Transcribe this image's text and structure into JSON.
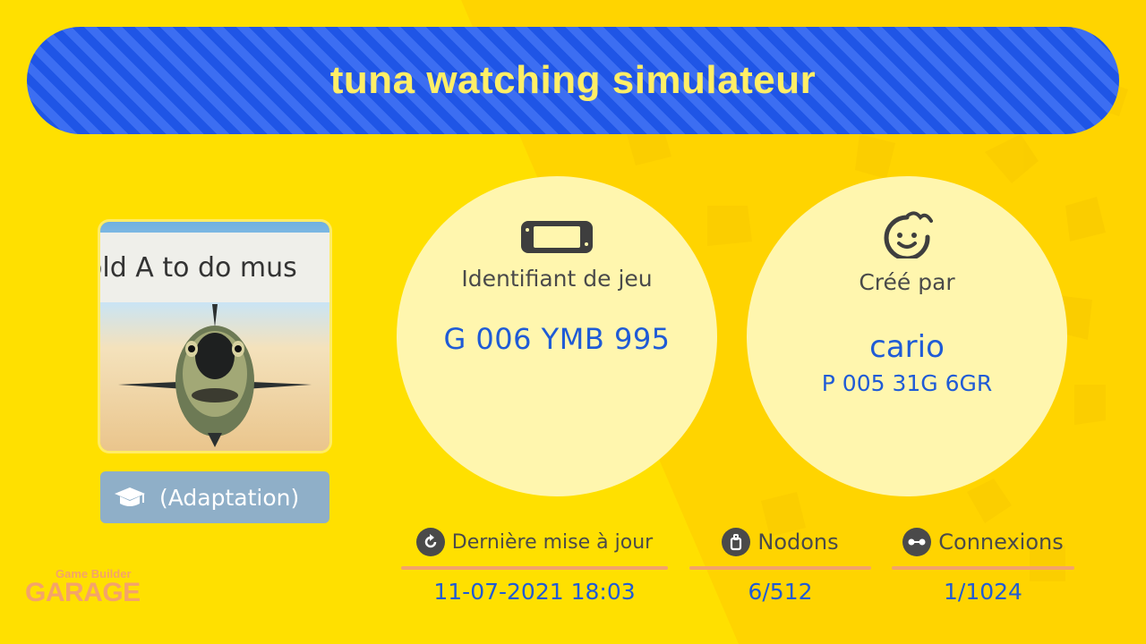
{
  "game": {
    "title": "tuna watching simulateur",
    "thumbnail_text": "old A to do mus",
    "adaptation_label": "(Adaptation)"
  },
  "game_id": {
    "label": "Identifiant de jeu",
    "value": "G 006 YMB 995",
    "icon": "console-icon"
  },
  "creator": {
    "label": "Créé par",
    "name": "cario",
    "id": "P 005 31G 6GR",
    "icon": "face-icon"
  },
  "stats": {
    "last_update": {
      "label": "Dernière mise à jour",
      "value": "11-07-2021 18:03",
      "icon": "refresh-icon"
    },
    "nodons": {
      "label": "Nodons",
      "value": "6/512",
      "icon": "nodon-icon"
    },
    "connections": {
      "label": "Connexions",
      "value": "1/1024",
      "icon": "connection-icon"
    }
  },
  "logo": {
    "small": "Game Builder",
    "big": "GARAGE"
  },
  "colors": {
    "background": "#FFE000",
    "banner_blue": "#1F55E6",
    "title_yellow": "#FFEE66",
    "value_blue": "#1F5BD6",
    "accent_orange": "#F4A36A",
    "circle_fill": "#FFF6AE"
  }
}
